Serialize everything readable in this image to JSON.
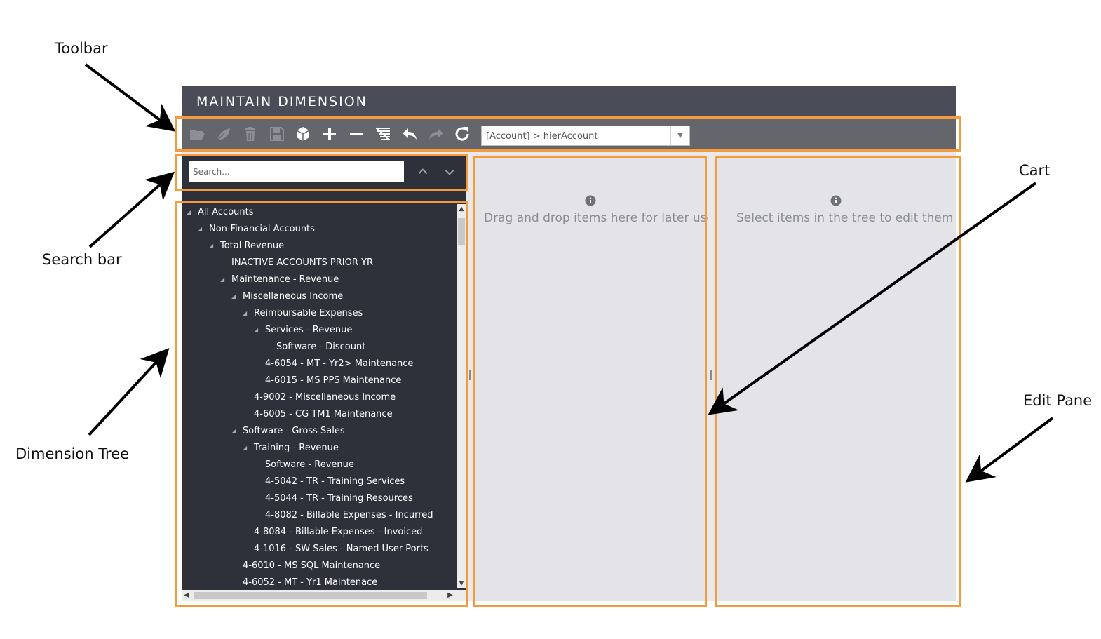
{
  "callouts": {
    "toolbar": "Toolbar",
    "search_bar": "Search bar",
    "dimension_tree": "Dimension Tree",
    "cart": "Cart",
    "edit_pane": "Edit Pane"
  },
  "app": {
    "title": "MAINTAIN DIMENSION",
    "toolbar": {
      "icons": [
        "open-folder-icon",
        "leaf-icon",
        "trash-icon",
        "save-icon",
        "cube-icon",
        "plus-icon",
        "minus-icon",
        "filter-list-icon",
        "undo-icon",
        "redo-icon",
        "refresh-icon"
      ],
      "hierarchy_value": "[Account] > hierAccount"
    },
    "search": {
      "placeholder": "Search..."
    },
    "tree": [
      {
        "label": "All Accounts",
        "level": 0,
        "expanded": true
      },
      {
        "label": "Non-Financial Accounts",
        "level": 1,
        "expanded": true
      },
      {
        "label": "Total Revenue",
        "level": 2,
        "expanded": true
      },
      {
        "label": "INACTIVE ACCOUNTS PRIOR YR",
        "level": 3,
        "expanded": false
      },
      {
        "label": "Maintenance - Revenue",
        "level": 3,
        "expanded": true
      },
      {
        "label": "Miscellaneous Income",
        "level": 4,
        "expanded": true
      },
      {
        "label": "Reimbursable Expenses",
        "level": 5,
        "expanded": true
      },
      {
        "label": "Services - Revenue",
        "level": 6,
        "expanded": true
      },
      {
        "label": "Software - Discount",
        "level": 7,
        "expanded": false
      },
      {
        "label": "4-6054 - MT - Yr2> Maintenance",
        "level": 6,
        "expanded": false
      },
      {
        "label": "4-6015 - MS PPS Maintenance",
        "level": 6,
        "expanded": false
      },
      {
        "label": "4-9002 - Miscellaneous Income",
        "level": 5,
        "expanded": false
      },
      {
        "label": "4-6005 - CG TM1 Maintenance",
        "level": 5,
        "expanded": false
      },
      {
        "label": "Software - Gross Sales",
        "level": 4,
        "expanded": true
      },
      {
        "label": "Training - Revenue",
        "level": 5,
        "expanded": true
      },
      {
        "label": "Software - Revenue",
        "level": 6,
        "expanded": false
      },
      {
        "label": "4-5042 - TR - Training Services",
        "level": 6,
        "expanded": false
      },
      {
        "label": "4-5044 - TR - Training Resources",
        "level": 6,
        "expanded": false
      },
      {
        "label": "4-8082 - Billable Expenses - Incurred",
        "level": 6,
        "expanded": false
      },
      {
        "label": "4-8084 - Billable Expenses - Invoiced",
        "level": 5,
        "expanded": false
      },
      {
        "label": "4-1016 - SW Sales - Named User Ports",
        "level": 5,
        "expanded": false
      },
      {
        "label": "4-6010 - MS SQL Maintenance",
        "level": 4,
        "expanded": false
      },
      {
        "label": "4-6052 - MT - Yr1 Maintenace",
        "level": 4,
        "expanded": false
      }
    ],
    "cart": {
      "message": "Drag and drop items here for later use"
    },
    "edit_pane": {
      "message": "Select items in the tree to edit them"
    },
    "colors": {
      "highlight": "#f59a3d",
      "title_bar": "#4a4d57",
      "toolbar": "#65666b",
      "tree_bg": "#2e313a",
      "pane_bg": "#e3e3e8"
    }
  }
}
